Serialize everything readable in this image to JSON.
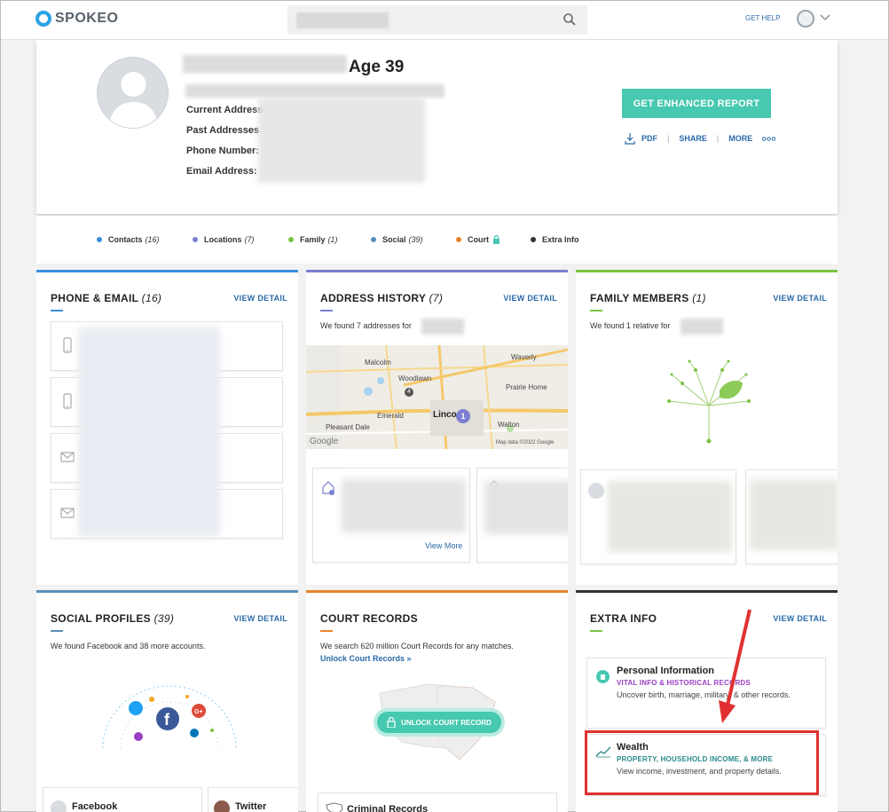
{
  "header": {
    "logo_text": "SPOKEO",
    "get_help": "GET HELP",
    "search_value": ""
  },
  "profile": {
    "age": "Age 39",
    "labels": {
      "current_address": "Current Address",
      "past_addresses": "Past Addresses",
      "phone_number": "Phone Number:",
      "email_address": "Email Address:"
    },
    "report_button": "GET ENHANCED REPORT",
    "actions": {
      "pdf": "PDF",
      "share": "SHARE",
      "more": "MORE"
    }
  },
  "categories": [
    {
      "label": "Contacts",
      "count": "(16)",
      "color": "#3b8fd9"
    },
    {
      "label": "Locations",
      "count": "(7)",
      "color": "#7b7fd0"
    },
    {
      "label": "Family",
      "count": "(1)",
      "color": "#7cc242"
    },
    {
      "label": "Social",
      "count": "(39)",
      "color": "#5a8fb8"
    },
    {
      "label": "Court",
      "count": "",
      "color": "#e8832a"
    },
    {
      "label": "Extra Info",
      "count": "",
      "color": "#333333"
    }
  ],
  "cards": {
    "phone_email": {
      "title": "PHONE & EMAIL",
      "count": "(16)",
      "view_detail": "VIEW DETAIL",
      "accent": "#3b8fd9"
    },
    "address_history": {
      "title": "ADDRESS HISTORY",
      "count": "(7)",
      "view_detail": "VIEW DETAIL",
      "subtitle": "We found 7 addresses for",
      "accent": "#7b7fd0",
      "map_labels": [
        "Malcolm",
        "Waverly",
        "Woodlawn",
        "Prairie Home",
        "Emerald",
        "Linco",
        "Walton",
        "Pleasant Dale",
        "Google",
        "Map data ©2022 Google"
      ],
      "view_more": "View More"
    },
    "family_members": {
      "title": "FAMILY MEMBERS",
      "count": "(1)",
      "view_detail": "VIEW DETAIL",
      "subtitle": "We found 1 relative for",
      "accent": "#7cc242"
    },
    "social_profiles": {
      "title": "SOCIAL PROFILES",
      "count": "(39)",
      "view_detail": "VIEW DETAIL",
      "subtitle": "We found Facebook and 38 more accounts.",
      "accent": "#5a8fb8",
      "profiles": [
        "Facebook",
        "Twitter"
      ]
    },
    "court_records": {
      "title": "COURT RECORDS",
      "accent": "#e8832a",
      "subtitle": "We search 620 million Court Records for any matches.",
      "unlock_link": "Unlock Court Records »",
      "unlock_button": "UNLOCK COURT RECORD",
      "criminal": "Criminal Records"
    },
    "extra_info": {
      "title": "EXTRA INFO",
      "view_detail": "VIEW DETAIL",
      "accent": "#333333",
      "items": [
        {
          "title": "Personal Information",
          "sub": "VITAL INFO & HISTORICAL RECORDS",
          "desc": "Uncover birth, marriage, military, & other records.",
          "sub_color": "#9b3fc4"
        },
        {
          "title": "Wealth",
          "sub": "PROPERTY, HOUSEHOLD INCOME, & MORE",
          "desc": "View income, investment, and property details.",
          "sub_color": "#2a8a8a"
        }
      ]
    }
  },
  "annotation": {
    "highlight_color": "#e03030"
  }
}
